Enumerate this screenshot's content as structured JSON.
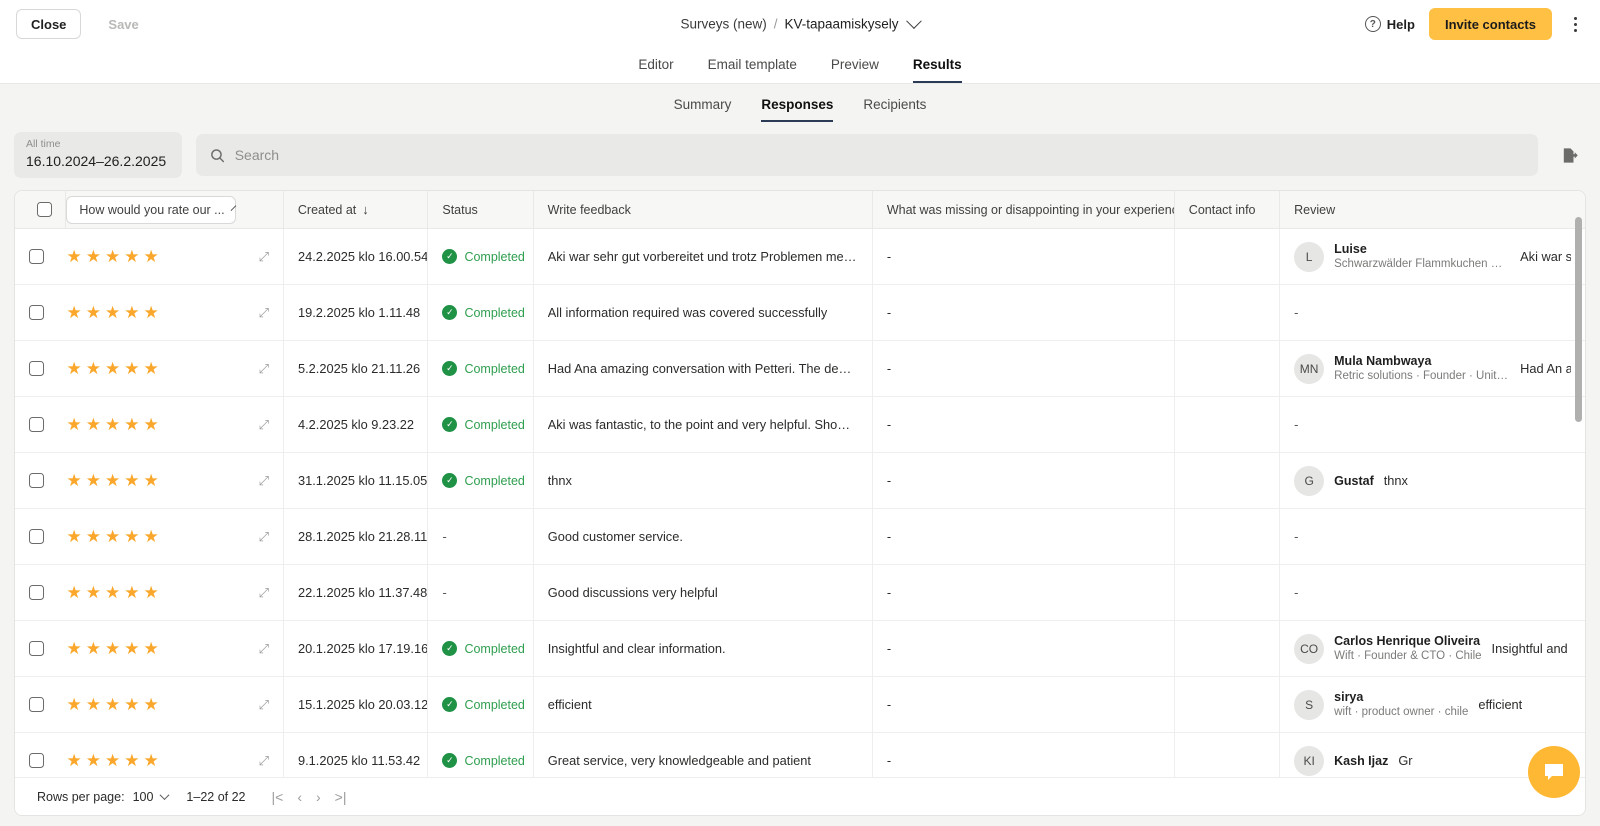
{
  "topbar": {
    "close_label": "Close",
    "save_label": "Save",
    "breadcrumb_root": "Surveys (new)",
    "breadcrumb_sep": "/",
    "breadcrumb_current": "KV-tapaamiskysely",
    "help_label": "Help",
    "help_glyph": "?",
    "invite_label": "Invite contacts"
  },
  "tabs": [
    {
      "label": "Editor",
      "active": false
    },
    {
      "label": "Email template",
      "active": false
    },
    {
      "label": "Preview",
      "active": false
    },
    {
      "label": "Results",
      "active": true
    }
  ],
  "subtabs": [
    {
      "label": "Summary",
      "active": false
    },
    {
      "label": "Responses",
      "active": true
    },
    {
      "label": "Recipients",
      "active": false
    }
  ],
  "filters": {
    "date_label": "All time",
    "date_value": "16.10.2024–26.2.2025",
    "search_value": "",
    "search_placeholder": "Search"
  },
  "table": {
    "rating_filter_label": "How would you rate our ...",
    "columns": [
      "Created at",
      "Status",
      "Write feedback",
      "What was missing or disappointing in your experience wit",
      "Contact info",
      "Review"
    ],
    "sort_indicator": "↓",
    "star_glyph": "★",
    "expand_glyph": "⤢",
    "status_tick": "✓",
    "empty_value": "-",
    "rows": [
      {
        "stars": 5,
        "created": "24.2.2025 klo 16.00.54",
        "status": "Completed",
        "feedback": "Aki war sehr gut vorbereitet und trotz Problemen meiner Seite ...",
        "missing": "-",
        "contact": "",
        "review": {
          "initials": "L",
          "name": "Luise",
          "meta": "Schwarzwälder Flammkuchen Ma...",
          "quote": "Aki war seh"
        }
      },
      {
        "stars": 5,
        "created": "19.2.2025 klo 1.11.48",
        "status": "Completed",
        "feedback": "All information required was covered successfully",
        "missing": "-",
        "contact": "",
        "review": {
          "empty": "-"
        }
      },
      {
        "stars": 5,
        "created": "5.2.2025 klo 21.11.26",
        "status": "Completed",
        "feedback": "Had Ana amazing conversation with Petteri. The demo call was ...",
        "missing": "-",
        "contact": "",
        "review": {
          "initials": "MN",
          "name": "Mula Nambwaya",
          "meta": "Retric solutions · Founder · Unite...",
          "quote": "Had An am"
        }
      },
      {
        "stars": 5,
        "created": "4.2.2025 klo 9.23.22",
        "status": "Completed",
        "feedback": "Aki was fantastic, to the point and very helpful. Showed all the ...",
        "missing": "-",
        "contact": "",
        "review": {
          "empty": "-"
        }
      },
      {
        "stars": 5,
        "created": "31.1.2025 klo 11.15.05",
        "status": "Completed",
        "feedback": "thnx",
        "missing": "-",
        "contact": "",
        "review": {
          "initials": "G",
          "name": "Gustaf",
          "meta": "",
          "quote": "thnx"
        }
      },
      {
        "stars": 5,
        "created": "28.1.2025 klo 21.28.11",
        "status": "-",
        "feedback": "Good customer service.",
        "missing": "-",
        "contact": "",
        "review": {
          "empty": "-"
        }
      },
      {
        "stars": 5,
        "created": "22.1.2025 klo 11.37.48",
        "status": "-",
        "feedback": "Good discussions very helpful",
        "missing": "-",
        "contact": "",
        "review": {
          "empty": "-"
        }
      },
      {
        "stars": 5,
        "created": "20.1.2025 klo 17.19.16",
        "status": "Completed",
        "feedback": "Insightful and clear information.",
        "missing": "-",
        "contact": "",
        "review": {
          "initials": "CO",
          "name": "Carlos Henrique Oliveira",
          "meta": "Wift · Founder & CTO · Chile",
          "quote": "Insightful and cle"
        }
      },
      {
        "stars": 5,
        "created": "15.1.2025 klo 20.03.12",
        "status": "Completed",
        "feedback": "efficient",
        "missing": "-",
        "contact": "",
        "review": {
          "initials": "S",
          "name": "sirya",
          "meta": "wift · product owner · chile",
          "quote": "efficient"
        }
      },
      {
        "stars": 5,
        "created": "9.1.2025 klo 11.53.42",
        "status": "Completed",
        "feedback": "Great service, very knowledgeable and patient",
        "missing": "-",
        "contact": "",
        "review": {
          "initials": "KI",
          "name": "Kash Ijaz",
          "meta": "",
          "quote": "Gr"
        }
      }
    ]
  },
  "footer": {
    "rows_per_page_label": "Rows per page:",
    "rows_per_page_value": "100",
    "range_label": "1–22 of 22",
    "first_glyph": "|<",
    "prev_glyph": "‹",
    "next_glyph": "›",
    "last_glyph": ">|"
  },
  "colors": {
    "accent": "#ffc043",
    "status_green": "#2f9e4f",
    "star": "#faa72c",
    "tab_underline": "#2b3a55"
  }
}
